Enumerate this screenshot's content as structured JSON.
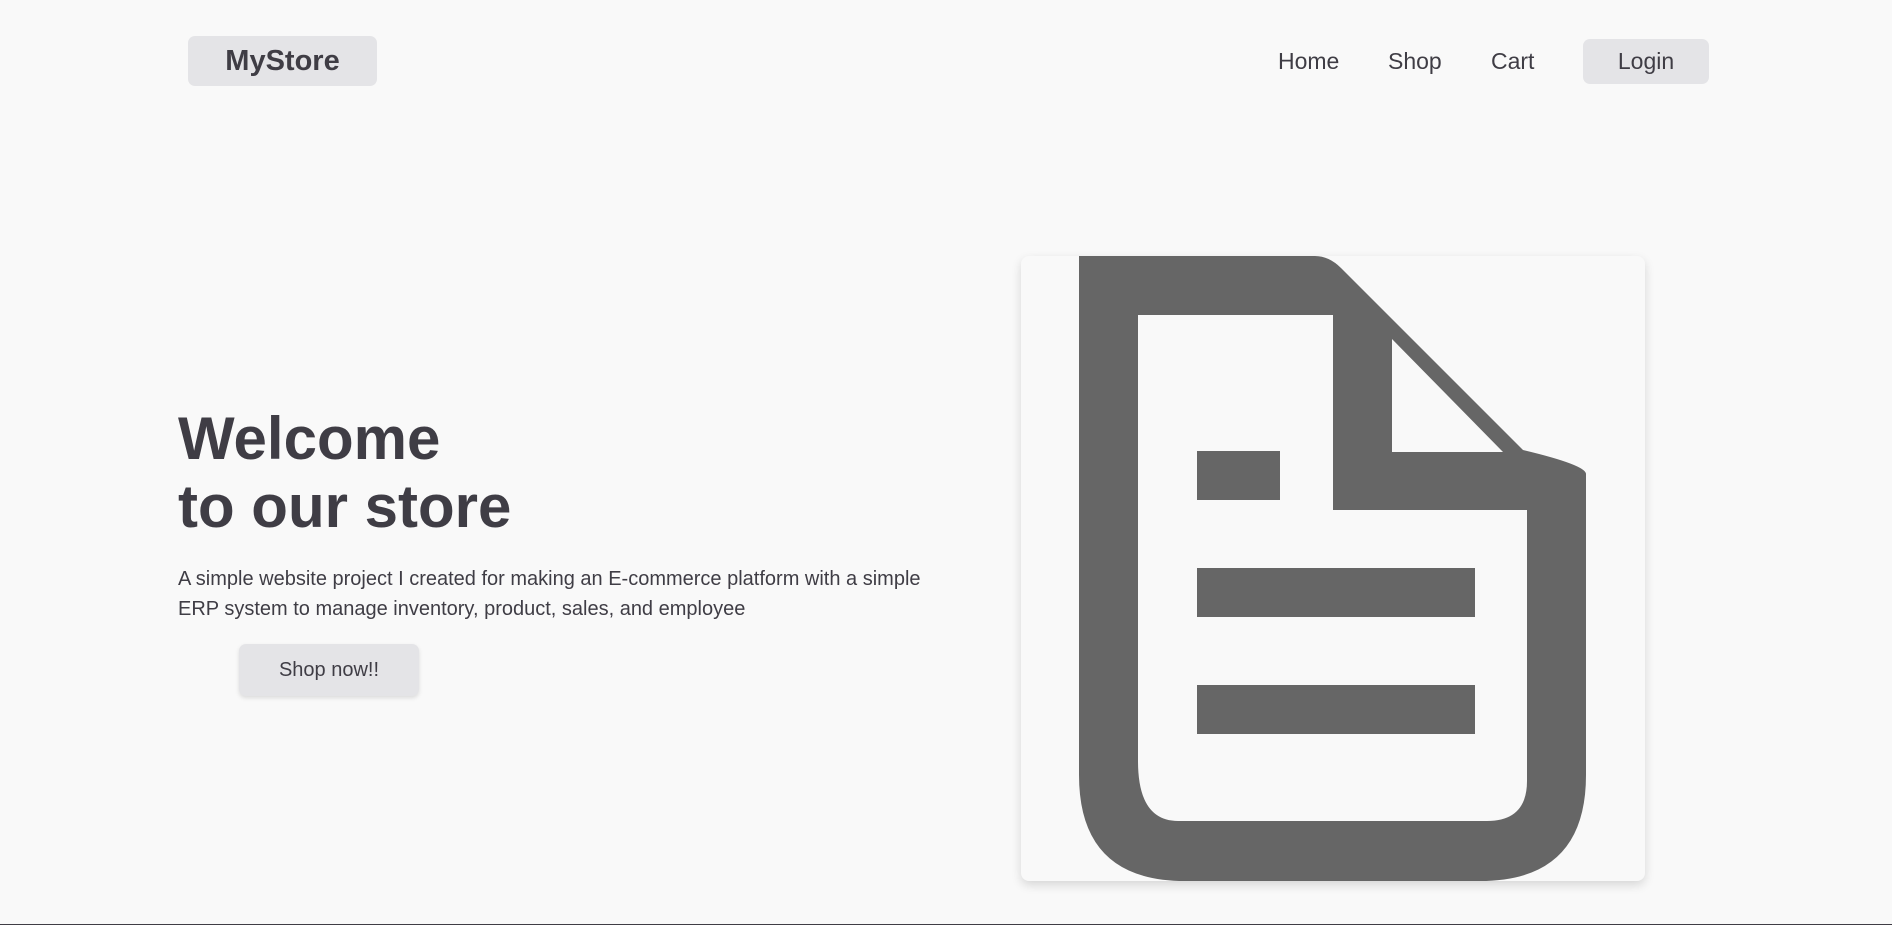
{
  "header": {
    "logo": "MyStore",
    "nav": [
      {
        "label": "Home"
      },
      {
        "label": "Shop"
      },
      {
        "label": "Cart"
      }
    ],
    "login_label": "Login"
  },
  "hero": {
    "title_line1": "Welcome",
    "title_line2": "to our store",
    "description": "A simple website project I created for making an E-commerce platform with a simple ERP system to manage inventory, product, sales, and employee",
    "cta_label": "Shop now!!"
  },
  "illustration": {
    "icon": "document-icon",
    "color": "#666666"
  }
}
